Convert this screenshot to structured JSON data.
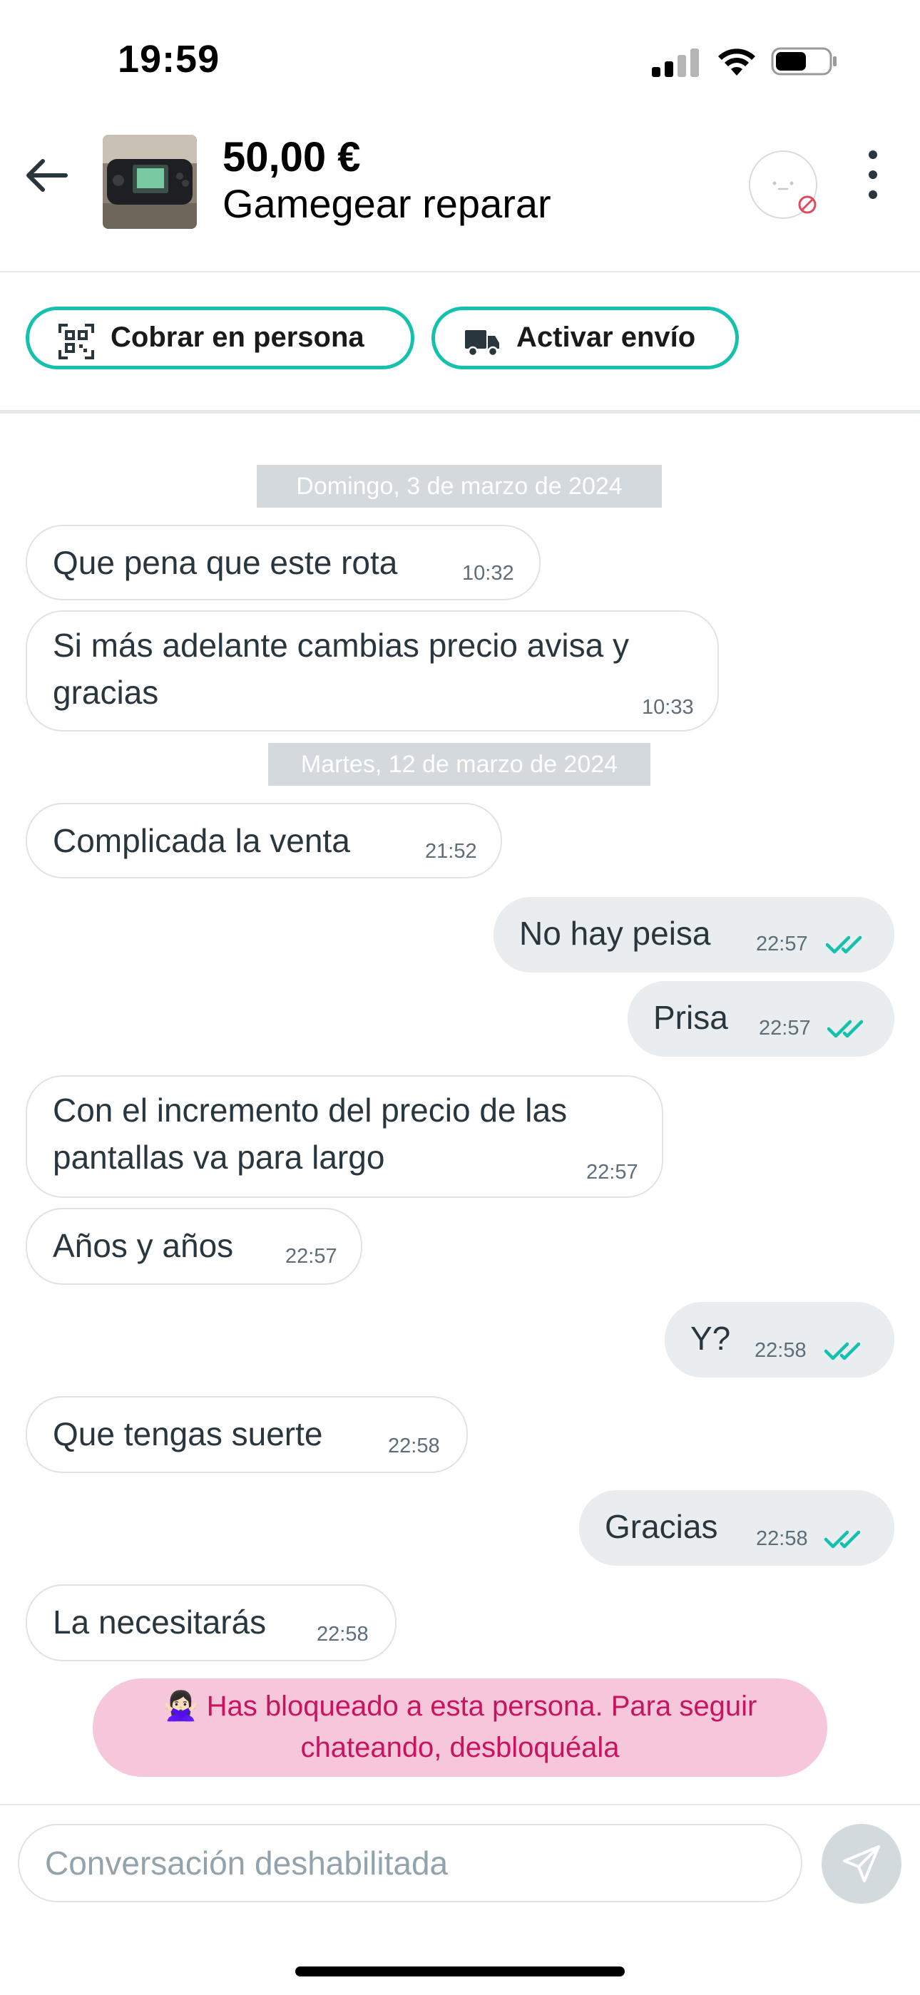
{
  "status_bar": {
    "time": "19:59"
  },
  "header": {
    "price": "50,00 €",
    "title": "Gamegear reparar"
  },
  "actions": {
    "collect_in_person": "Cobrar en persona",
    "activate_shipping": "Activar envío"
  },
  "dates": [
    "Domingo, 3 de marzo de 2024",
    "Martes, 12 de marzo de 2024"
  ],
  "messages": [
    {
      "direction": "in",
      "lines": [
        "Que pena que este rota"
      ],
      "time": "10:32"
    },
    {
      "direction": "in",
      "lines": [
        "Si más adelante cambias precio avisa y",
        "gracias"
      ],
      "time": "10:33"
    },
    {
      "direction": "in",
      "lines": [
        "Complicada la venta"
      ],
      "time": "21:52"
    },
    {
      "direction": "out",
      "lines": [
        "No hay peisa"
      ],
      "time": "22:57",
      "read": true
    },
    {
      "direction": "out",
      "lines": [
        "Prisa"
      ],
      "time": "22:57",
      "read": true
    },
    {
      "direction": "in",
      "lines": [
        "Con el incremento del precio de las",
        "pantallas va para largo"
      ],
      "time": "22:57"
    },
    {
      "direction": "in",
      "lines": [
        "Años y años"
      ],
      "time": "22:57"
    },
    {
      "direction": "out",
      "lines": [
        "Y?"
      ],
      "time": "22:58",
      "read": true
    },
    {
      "direction": "in",
      "lines": [
        "Que tengas suerte"
      ],
      "time": "22:58"
    },
    {
      "direction": "out",
      "lines": [
        "Gracias"
      ],
      "time": "22:58",
      "read": true
    },
    {
      "direction": "in",
      "lines": [
        "La necesitarás"
      ],
      "time": "22:58"
    }
  ],
  "blocked_notice": {
    "emoji": "🙅🏻‍♀️",
    "line1": "Has bloqueado a esta persona. Para seguir",
    "line2": "chateando, desbloquéala"
  },
  "composer": {
    "placeholder": "Conversación deshabilitada"
  },
  "colors": {
    "accent": "#13c1ac",
    "blocked_bg": "#f6c7da",
    "blocked_text": "#c9135e"
  }
}
